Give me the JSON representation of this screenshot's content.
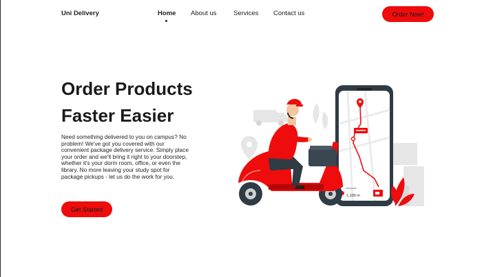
{
  "header": {
    "brand": "Uni Delivery",
    "nav": [
      "Home",
      "About us",
      "Services",
      "Contact us"
    ],
    "active_nav": "Home",
    "cta_label": "Order Now!"
  },
  "hero": {
    "title_line1": "Order Products",
    "title_line2": "Faster Easier",
    "description": "Need something delivered to you on campus? No problem! We've got you covered with our convenient package delivery service. Simply place your order and we'll bring it right to your doorstep, whether it's your dorm room, office, or even the library. No more leaving your study spot for package pickups - let us do the work for you.",
    "cta_label": "Get Started"
  },
  "illustration": {
    "distance_label": "1,100 m"
  },
  "colors": {
    "accent": "#ee0c0c",
    "text": "#1e1e1e",
    "background": "#ffffff"
  }
}
